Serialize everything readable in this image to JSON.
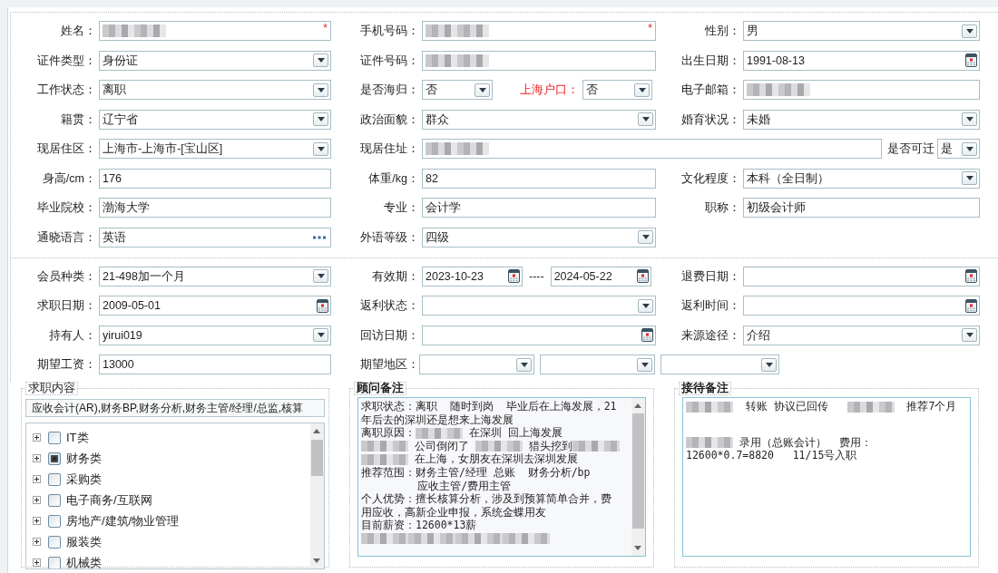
{
  "personal": [
    {
      "label": "姓名：",
      "kind": "text",
      "blurred": true,
      "marker": "*",
      "highlight": false
    },
    {
      "label": "手机号码：",
      "kind": "text",
      "blurred": true,
      "marker": "*",
      "highlight": false
    },
    {
      "label": "性别：",
      "kind": "select",
      "value": "男",
      "highlight": false
    },
    {
      "label": "证件类型：",
      "kind": "select",
      "value": "身份证",
      "highlight": false
    },
    {
      "label": "证件号码：",
      "kind": "text",
      "blurred": true,
      "highlight": false
    },
    {
      "label": "出生日期：",
      "kind": "date",
      "value": "1991-08-13",
      "highlight": false
    },
    {
      "label": "工作状态：",
      "kind": "select",
      "value": "离职",
      "highlight": false
    },
    {
      "label": "是否海归：",
      "kind": "select",
      "value": "否",
      "highlight": false
    },
    {
      "label": "上海户口：",
      "kind": "select",
      "value": "否",
      "highlight": true
    },
    {
      "label": "电子邮箱：",
      "kind": "text",
      "blurred": true,
      "highlight": false
    },
    {
      "label": "籍贯：",
      "kind": "select",
      "value": "辽宁省",
      "highlight": false
    },
    {
      "label": "政治面貌：",
      "kind": "select",
      "value": "群众",
      "highlight": false
    },
    {
      "label": "婚育状况：",
      "kind": "select",
      "value": "未婚",
      "highlight": false
    },
    {
      "label": "现居住区：",
      "kind": "select",
      "value": "上海市-上海市-[宝山区]",
      "highlight": false
    },
    {
      "label": "现居住址：",
      "kind": "text",
      "blurred": true,
      "highlight": false
    },
    {
      "label": "是否可迁",
      "kind": "select",
      "value": "是",
      "highlight": false
    },
    {
      "label": "身高/cm：",
      "kind": "text",
      "value": "176",
      "highlight": false
    },
    {
      "label": "体重/kg：",
      "kind": "text",
      "value": "82",
      "highlight": false
    },
    {
      "label": "文化程度：",
      "kind": "select",
      "value": "本科（全日制）",
      "highlight": false
    },
    {
      "label": "毕业院校：",
      "kind": "text",
      "value": "渤海大学",
      "highlight": false
    },
    {
      "label": "专业：",
      "kind": "text",
      "value": "会计学",
      "highlight": false
    },
    {
      "label": "职称：",
      "kind": "text",
      "value": "初级会计师",
      "highlight": false
    },
    {
      "label": "通晓语言：",
      "kind": "picker",
      "value": "英语",
      "highlight": false
    },
    {
      "label": "外语等级：",
      "kind": "select",
      "value": "四级",
      "highlight": false
    }
  ],
  "membership": {
    "range_separator": "----",
    "fields": [
      {
        "label": "会员种类：",
        "kind": "select",
        "value": "21-498加一个月"
      },
      {
        "label": "有效期：",
        "kind": "date",
        "value": "2023-10-23"
      },
      {
        "kind": "date",
        "value": "2024-05-22"
      },
      {
        "label": "退费日期：",
        "kind": "date"
      },
      {
        "label": "求职日期：",
        "kind": "date",
        "value": "2009-05-01"
      },
      {
        "label": "返利状态：",
        "kind": "select"
      },
      {
        "label": "返利时间：",
        "kind": "date"
      },
      {
        "label": "持有人：",
        "kind": "select",
        "value": "yirui019"
      },
      {
        "label": "回访日期：",
        "kind": "date"
      },
      {
        "label": "来源途径：",
        "kind": "select",
        "value": "介绍"
      },
      {
        "label": "期望工资：",
        "kind": "text",
        "value": "13000"
      },
      {
        "label": "期望地区：",
        "kind": "select"
      },
      {
        "kind": "select"
      },
      {
        "kind": "select"
      }
    ]
  },
  "job_content": {
    "title": "求职内容",
    "summary": "应收会计(AR),财务BP,财务分析,财务主管/经理/总监,核算",
    "categories": [
      {
        "label": "IT类",
        "checked": false,
        "expanded": false
      },
      {
        "label": "财务类",
        "checked": true,
        "expanded": false
      },
      {
        "label": "采购类",
        "checked": false,
        "expanded": false
      },
      {
        "label": "电子商务/互联网",
        "checked": false,
        "expanded": false
      },
      {
        "label": "房地产/建筑/物业管理",
        "checked": false,
        "expanded": false
      },
      {
        "label": "服装类",
        "checked": false,
        "expanded": false
      },
      {
        "label": "机械类",
        "checked": false,
        "expanded": false
      }
    ]
  },
  "advisor_notes": {
    "title": "顾问备注",
    "lines": [
      [
        {
          "kind": "text",
          "text": "求职状态：离职  随时到岗  毕业后在上海发展，21"
        }
      ],
      [
        {
          "kind": "text",
          "text": "年后去的深圳还是想来上海发展"
        }
      ],
      [
        {
          "kind": "text",
          "text": "离职原因："
        },
        {
          "kind": "blur"
        },
        {
          "kind": "text",
          "text": " 在深圳 回上海发展"
        }
      ],
      [
        {
          "kind": "blur"
        },
        {
          "kind": "text",
          "text": " 公司倒闭了 "
        },
        {
          "kind": "blur"
        },
        {
          "kind": "text",
          "text": " 猎头挖到"
        },
        {
          "kind": "blur"
        }
      ],
      [
        {
          "kind": "blur"
        },
        {
          "kind": "text",
          "text": " 在上海，女朋友在深圳去深圳发展"
        }
      ],
      [
        {
          "kind": "text",
          "text": "推荐范围：财务主管/经理 总账  财务分析/bp"
        }
      ],
      [
        {
          "kind": "text",
          "text": "         应收主管/费用主管"
        }
      ],
      [
        {
          "kind": "text",
          "text": "个人优势：擅长核算分析，涉及到预算简单合并，费"
        }
      ],
      [
        {
          "kind": "text",
          "text": "用应收，高新企业申报，系统金蝶用友"
        }
      ],
      [
        {
          "kind": "text",
          "text": "目前薪资：12600*13薪"
        }
      ],
      [
        {
          "kind": "blur"
        },
        {
          "kind": "blur"
        },
        {
          "kind": "blur"
        },
        {
          "kind": "blur"
        }
      ]
    ]
  },
  "reception_notes": {
    "title": "接待备注",
    "paragraphs": [
      [
        [
          {
            "kind": "blur"
          },
          {
            "kind": "text",
            "text": "  转账 协议已回传   "
          },
          {
            "kind": "blur"
          },
          {
            "kind": "text",
            "text": "  推荐7个月"
          }
        ]
      ],
      [
        [
          {
            "kind": "blur"
          },
          {
            "kind": "text",
            "text": " 录用（总账会计）  费用："
          }
        ],
        [
          {
            "kind": "text",
            "text": "12600*0.7=8820   11/15号入职"
          }
        ]
      ]
    ]
  }
}
